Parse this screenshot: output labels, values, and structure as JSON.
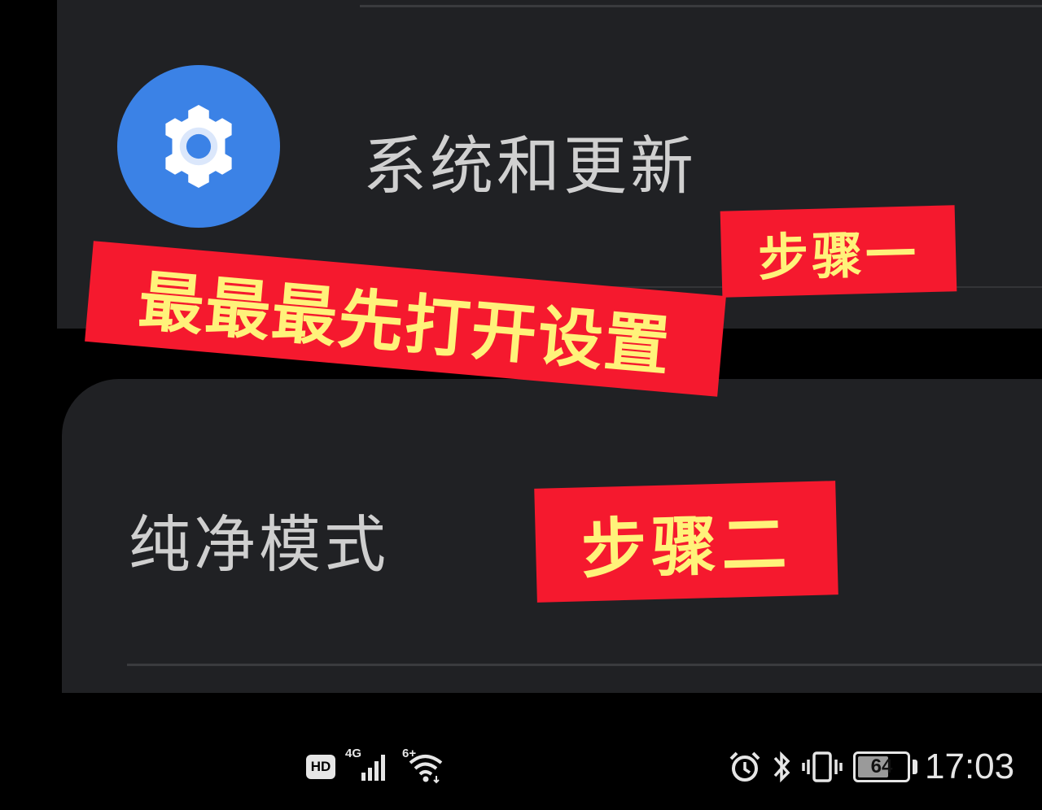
{
  "settings": {
    "system_update": {
      "label": "系统和更新",
      "icon": "gear-icon",
      "icon_bg": "#3b82e6"
    },
    "pure_mode": {
      "label": "纯净模式"
    }
  },
  "annotations": {
    "step1": "步骤一",
    "main_instruction": "最最最先打开设置",
    "step2": "步骤二",
    "tag_color": "#f5192e",
    "text_color": "#fff27a"
  },
  "status_bar": {
    "hd": "HD",
    "network": "4G",
    "wifi": "6+",
    "battery": "64",
    "battery_level": 0.64,
    "time": "17:03",
    "icons": [
      "hd-icon",
      "signal-4g-icon",
      "wifi-6-icon",
      "alarm-icon",
      "bluetooth-icon",
      "vibrate-icon",
      "battery-icon"
    ]
  }
}
